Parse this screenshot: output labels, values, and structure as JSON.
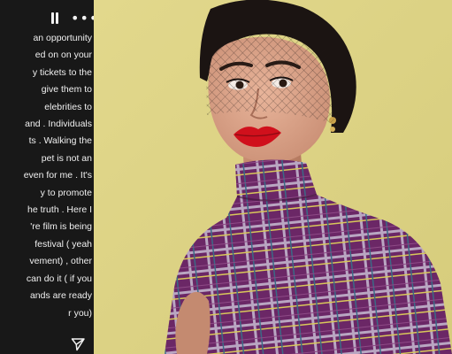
{
  "story": {
    "lines": [
      "an opportunity",
      "ed on on your",
      "y tickets to the",
      "give them to",
      "elebrities to",
      "and . Individuals",
      "ts . Walking the",
      "pet is not an",
      "even for me . It's",
      "y to promote",
      "he truth . Here I",
      "'re film is being",
      "festival ( yeah",
      "vement) , other",
      "can do it ( if you",
      "ands are ready",
      "r you)"
    ],
    "icons": {
      "pause": "pause-icon",
      "more": "more-icon",
      "send": "send-icon"
    },
    "colors": {
      "panel_bg": "#181818",
      "text": "#f0f0f0"
    }
  },
  "photo": {
    "colors": {
      "backdrop": "#ded486",
      "outfit": "#6e2a6a",
      "lips": "#d0101c"
    }
  }
}
